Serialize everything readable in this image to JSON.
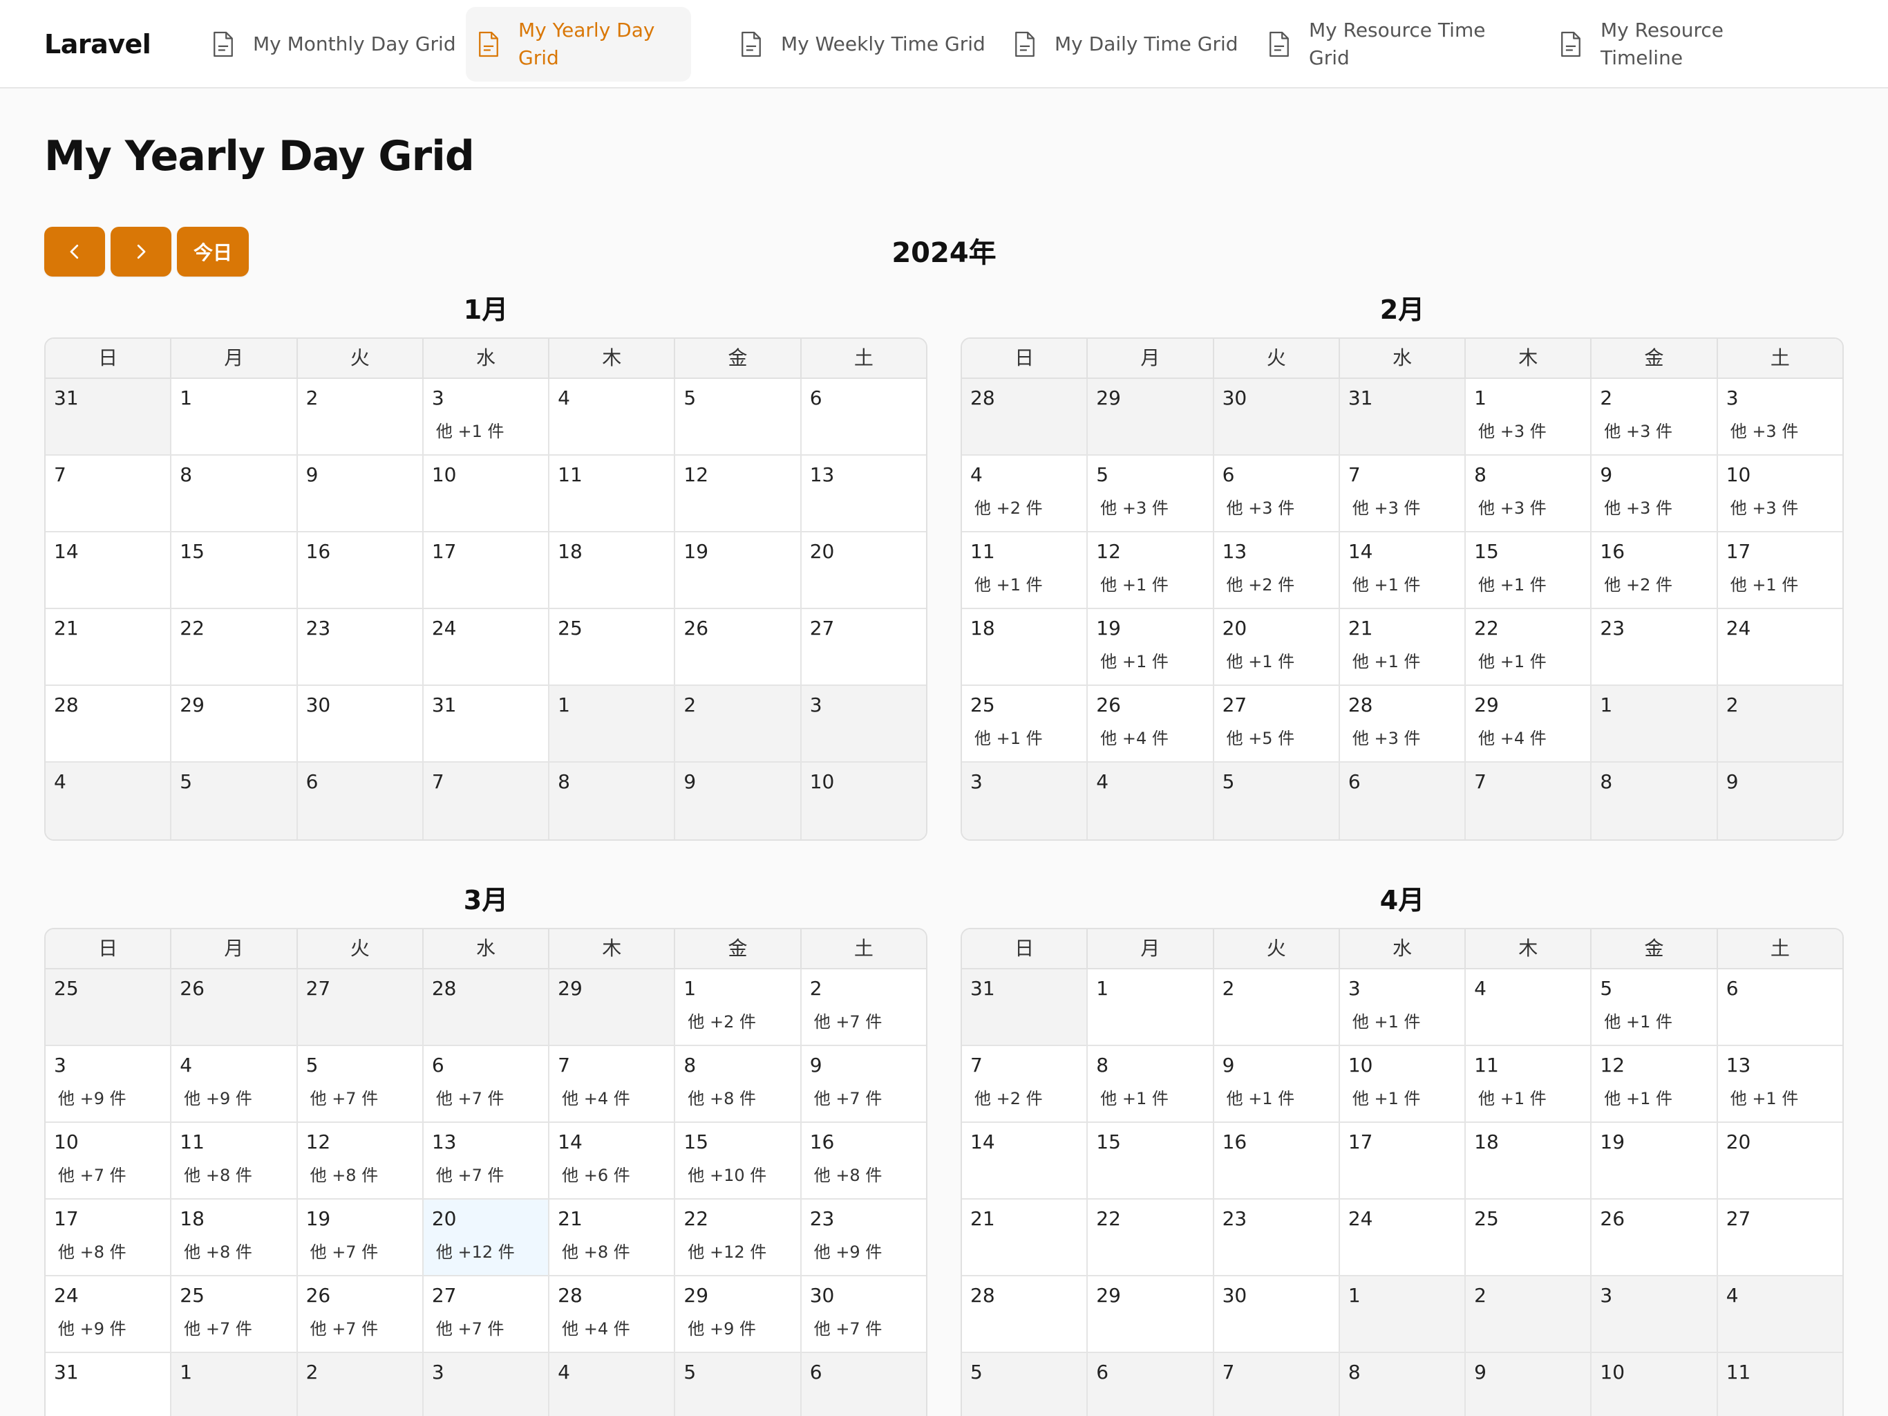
{
  "brand": "Laravel",
  "nav": [
    {
      "label": "My Monthly Day Grid",
      "active": false
    },
    {
      "label": "My Yearly Day Grid",
      "active": true
    },
    {
      "label": "My Weekly Time Grid",
      "active": false
    },
    {
      "label": "My Daily Time Grid",
      "active": false
    },
    {
      "label": "My Resource Time Grid",
      "active": false
    },
    {
      "label": "My Resource Timeline",
      "active": false
    }
  ],
  "page_title": "My Yearly Day Grid",
  "toolbar": {
    "prev_icon": "chevron-left-icon",
    "next_icon": "chevron-right-icon",
    "today_label": "今日"
  },
  "year_title": "2024年",
  "weekdays": [
    "日",
    "月",
    "火",
    "水",
    "木",
    "金",
    "土"
  ],
  "colors": {
    "accent": "#d97706",
    "other_month_cell": "#f3f3f3",
    "today_cell": "#eff8ff"
  },
  "months": [
    {
      "title": "1月",
      "weeks": [
        [
          {
            "d": "31",
            "o": true
          },
          {
            "d": "1"
          },
          {
            "d": "2"
          },
          {
            "d": "3",
            "m": "他 +1 件"
          },
          {
            "d": "4"
          },
          {
            "d": "5"
          },
          {
            "d": "6"
          }
        ],
        [
          {
            "d": "7"
          },
          {
            "d": "8"
          },
          {
            "d": "9"
          },
          {
            "d": "10"
          },
          {
            "d": "11"
          },
          {
            "d": "12"
          },
          {
            "d": "13"
          }
        ],
        [
          {
            "d": "14"
          },
          {
            "d": "15"
          },
          {
            "d": "16"
          },
          {
            "d": "17"
          },
          {
            "d": "18"
          },
          {
            "d": "19"
          },
          {
            "d": "20"
          }
        ],
        [
          {
            "d": "21"
          },
          {
            "d": "22"
          },
          {
            "d": "23"
          },
          {
            "d": "24"
          },
          {
            "d": "25"
          },
          {
            "d": "26"
          },
          {
            "d": "27"
          }
        ],
        [
          {
            "d": "28"
          },
          {
            "d": "29"
          },
          {
            "d": "30"
          },
          {
            "d": "31"
          },
          {
            "d": "1",
            "o": true
          },
          {
            "d": "2",
            "o": true
          },
          {
            "d": "3",
            "o": true
          }
        ],
        [
          {
            "d": "4",
            "o": true
          },
          {
            "d": "5",
            "o": true
          },
          {
            "d": "6",
            "o": true
          },
          {
            "d": "7",
            "o": true
          },
          {
            "d": "8",
            "o": true
          },
          {
            "d": "9",
            "o": true
          },
          {
            "d": "10",
            "o": true
          }
        ]
      ]
    },
    {
      "title": "2月",
      "weeks": [
        [
          {
            "d": "28",
            "o": true
          },
          {
            "d": "29",
            "o": true
          },
          {
            "d": "30",
            "o": true
          },
          {
            "d": "31",
            "o": true
          },
          {
            "d": "1",
            "m": "他 +3 件"
          },
          {
            "d": "2",
            "m": "他 +3 件"
          },
          {
            "d": "3",
            "m": "他 +3 件"
          }
        ],
        [
          {
            "d": "4",
            "m": "他 +2 件"
          },
          {
            "d": "5",
            "m": "他 +3 件"
          },
          {
            "d": "6",
            "m": "他 +3 件"
          },
          {
            "d": "7",
            "m": "他 +3 件"
          },
          {
            "d": "8",
            "m": "他 +3 件"
          },
          {
            "d": "9",
            "m": "他 +3 件"
          },
          {
            "d": "10",
            "m": "他 +3 件"
          }
        ],
        [
          {
            "d": "11",
            "m": "他 +1 件"
          },
          {
            "d": "12",
            "m": "他 +1 件"
          },
          {
            "d": "13",
            "m": "他 +2 件"
          },
          {
            "d": "14",
            "m": "他 +1 件"
          },
          {
            "d": "15",
            "m": "他 +1 件"
          },
          {
            "d": "16",
            "m": "他 +2 件"
          },
          {
            "d": "17",
            "m": "他 +1 件"
          }
        ],
        [
          {
            "d": "18"
          },
          {
            "d": "19",
            "m": "他 +1 件"
          },
          {
            "d": "20",
            "m": "他 +1 件"
          },
          {
            "d": "21",
            "m": "他 +1 件"
          },
          {
            "d": "22",
            "m": "他 +1 件"
          },
          {
            "d": "23"
          },
          {
            "d": "24"
          }
        ],
        [
          {
            "d": "25",
            "m": "他 +1 件"
          },
          {
            "d": "26",
            "m": "他 +4 件"
          },
          {
            "d": "27",
            "m": "他 +5 件"
          },
          {
            "d": "28",
            "m": "他 +3 件"
          },
          {
            "d": "29",
            "m": "他 +4 件"
          },
          {
            "d": "1",
            "o": true
          },
          {
            "d": "2",
            "o": true
          }
        ],
        [
          {
            "d": "3",
            "o": true
          },
          {
            "d": "4",
            "o": true
          },
          {
            "d": "5",
            "o": true
          },
          {
            "d": "6",
            "o": true
          },
          {
            "d": "7",
            "o": true
          },
          {
            "d": "8",
            "o": true
          },
          {
            "d": "9",
            "o": true
          }
        ]
      ]
    },
    {
      "title": "3月",
      "weeks": [
        [
          {
            "d": "25",
            "o": true
          },
          {
            "d": "26",
            "o": true
          },
          {
            "d": "27",
            "o": true
          },
          {
            "d": "28",
            "o": true
          },
          {
            "d": "29",
            "o": true
          },
          {
            "d": "1",
            "m": "他 +2 件"
          },
          {
            "d": "2",
            "m": "他 +7 件"
          }
        ],
        [
          {
            "d": "3",
            "m": "他 +9 件"
          },
          {
            "d": "4",
            "m": "他 +9 件"
          },
          {
            "d": "5",
            "m": "他 +7 件"
          },
          {
            "d": "6",
            "m": "他 +7 件"
          },
          {
            "d": "7",
            "m": "他 +4 件"
          },
          {
            "d": "8",
            "m": "他 +8 件"
          },
          {
            "d": "9",
            "m": "他 +7 件"
          }
        ],
        [
          {
            "d": "10",
            "m": "他 +7 件"
          },
          {
            "d": "11",
            "m": "他 +8 件"
          },
          {
            "d": "12",
            "m": "他 +8 件"
          },
          {
            "d": "13",
            "m": "他 +7 件"
          },
          {
            "d": "14",
            "m": "他 +6 件"
          },
          {
            "d": "15",
            "m": "他 +10 件"
          },
          {
            "d": "16",
            "m": "他 +8 件"
          }
        ],
        [
          {
            "d": "17",
            "m": "他 +8 件"
          },
          {
            "d": "18",
            "m": "他 +8 件"
          },
          {
            "d": "19",
            "m": "他 +7 件"
          },
          {
            "d": "20",
            "m": "他 +12 件",
            "t": true
          },
          {
            "d": "21",
            "m": "他 +8 件"
          },
          {
            "d": "22",
            "m": "他 +12 件"
          },
          {
            "d": "23",
            "m": "他 +9 件"
          }
        ],
        [
          {
            "d": "24",
            "m": "他 +9 件"
          },
          {
            "d": "25",
            "m": "他 +7 件"
          },
          {
            "d": "26",
            "m": "他 +7 件"
          },
          {
            "d": "27",
            "m": "他 +7 件"
          },
          {
            "d": "28",
            "m": "他 +4 件"
          },
          {
            "d": "29",
            "m": "他 +9 件"
          },
          {
            "d": "30",
            "m": "他 +7 件"
          }
        ],
        [
          {
            "d": "31"
          },
          {
            "d": "1",
            "o": true
          },
          {
            "d": "2",
            "o": true
          },
          {
            "d": "3",
            "o": true
          },
          {
            "d": "4",
            "o": true
          },
          {
            "d": "5",
            "o": true
          },
          {
            "d": "6",
            "o": true
          }
        ]
      ]
    },
    {
      "title": "4月",
      "weeks": [
        [
          {
            "d": "31",
            "o": true
          },
          {
            "d": "1"
          },
          {
            "d": "2"
          },
          {
            "d": "3",
            "m": "他 +1 件"
          },
          {
            "d": "4"
          },
          {
            "d": "5",
            "m": "他 +1 件"
          },
          {
            "d": "6"
          }
        ],
        [
          {
            "d": "7",
            "m": "他 +2 件"
          },
          {
            "d": "8",
            "m": "他 +1 件"
          },
          {
            "d": "9",
            "m": "他 +1 件"
          },
          {
            "d": "10",
            "m": "他 +1 件"
          },
          {
            "d": "11",
            "m": "他 +1 件"
          },
          {
            "d": "12",
            "m": "他 +1 件"
          },
          {
            "d": "13",
            "m": "他 +1 件"
          }
        ],
        [
          {
            "d": "14"
          },
          {
            "d": "15"
          },
          {
            "d": "16"
          },
          {
            "d": "17"
          },
          {
            "d": "18"
          },
          {
            "d": "19"
          },
          {
            "d": "20"
          }
        ],
        [
          {
            "d": "21"
          },
          {
            "d": "22"
          },
          {
            "d": "23"
          },
          {
            "d": "24"
          },
          {
            "d": "25"
          },
          {
            "d": "26"
          },
          {
            "d": "27"
          }
        ],
        [
          {
            "d": "28"
          },
          {
            "d": "29"
          },
          {
            "d": "30"
          },
          {
            "d": "1",
            "o": true
          },
          {
            "d": "2",
            "o": true
          },
          {
            "d": "3",
            "o": true
          },
          {
            "d": "4",
            "o": true
          }
        ],
        [
          {
            "d": "5",
            "o": true
          },
          {
            "d": "6",
            "o": true
          },
          {
            "d": "7",
            "o": true
          },
          {
            "d": "8",
            "o": true
          },
          {
            "d": "9",
            "o": true
          },
          {
            "d": "10",
            "o": true
          },
          {
            "d": "11",
            "o": true
          }
        ]
      ]
    }
  ]
}
